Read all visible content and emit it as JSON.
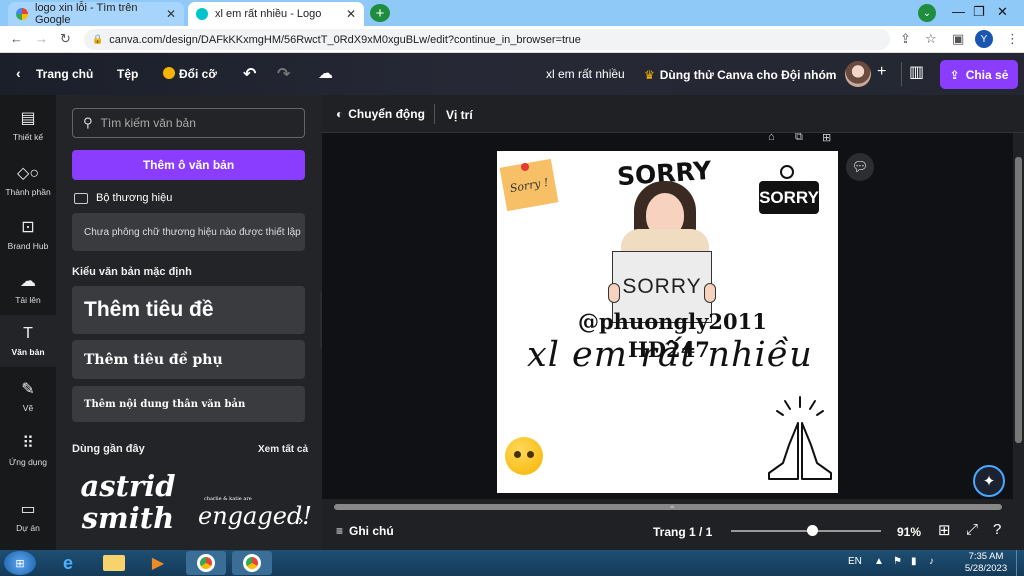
{
  "browser": {
    "tabs": [
      {
        "title": "logo xin lỗi - Tìm trên Google"
      },
      {
        "title": "xl em rất nhiều - Logo"
      }
    ],
    "url": "canva.com/design/DAFkKKxmgHM/56RwctT_0RdX9xM0xguBLw/edit?continue_in_browser=true",
    "profile_initial": "Y"
  },
  "header": {
    "home": "Trang chủ",
    "file": "Tệp",
    "resize": "Đổi cỡ",
    "title": "xl em rất nhiều",
    "try_canva": "Dùng thử Canva cho Đội nhóm",
    "share": "Chia sẻ"
  },
  "rail": [
    {
      "label": "Thiết kế",
      "icon": "layout-icon"
    },
    {
      "label": "Thành phần",
      "icon": "shapes-icon"
    },
    {
      "label": "Brand Hub",
      "icon": "brand-icon"
    },
    {
      "label": "Tải lên",
      "icon": "upload-icon"
    },
    {
      "label": "Văn bản",
      "icon": "text-icon"
    },
    {
      "label": "Vẽ",
      "icon": "draw-icon"
    },
    {
      "label": "Ứng dụng",
      "icon": "apps-icon"
    },
    {
      "label": "Dự án",
      "icon": "folder-icon"
    }
  ],
  "panel": {
    "search_placeholder": "Tìm kiếm văn bản",
    "add_textbox": "Thêm ô văn bản",
    "brand_kit": "Bộ thương hiệu",
    "brand_note": "Chưa phông chữ thương hiệu nào được thiết lập",
    "default_styles": "Kiểu văn bản mặc định",
    "add_heading": "Thêm tiêu đề",
    "add_subheading": "Thêm tiêu đề phụ",
    "add_body": "Thêm nội dung thân văn bản",
    "recent": "Dùng gần đây",
    "see_all": "Xem tất cả",
    "recent_1_line1": "astrid",
    "recent_1_line2": "smith",
    "recent_2_small": "charlie & katie are",
    "recent_2_big": "engaged!"
  },
  "toolbar": {
    "animate": "Chuyển động",
    "position": "Vị trí"
  },
  "design": {
    "note_text": "Sorry !",
    "sorry_top": "SORRY",
    "sorry_sign": "SORRY",
    "sorry_board": "SORRY",
    "handle": "@phuongly2011",
    "code": "HD247",
    "script": "xl em rất nhiều"
  },
  "bottom": {
    "notes": "Ghi chú",
    "page": "Trang 1 / 1",
    "zoom": "91%",
    "zoom_level": 0.91
  },
  "taskbar": {
    "lang": "EN",
    "time": "7:35 AM",
    "date": "5/28/2023"
  }
}
